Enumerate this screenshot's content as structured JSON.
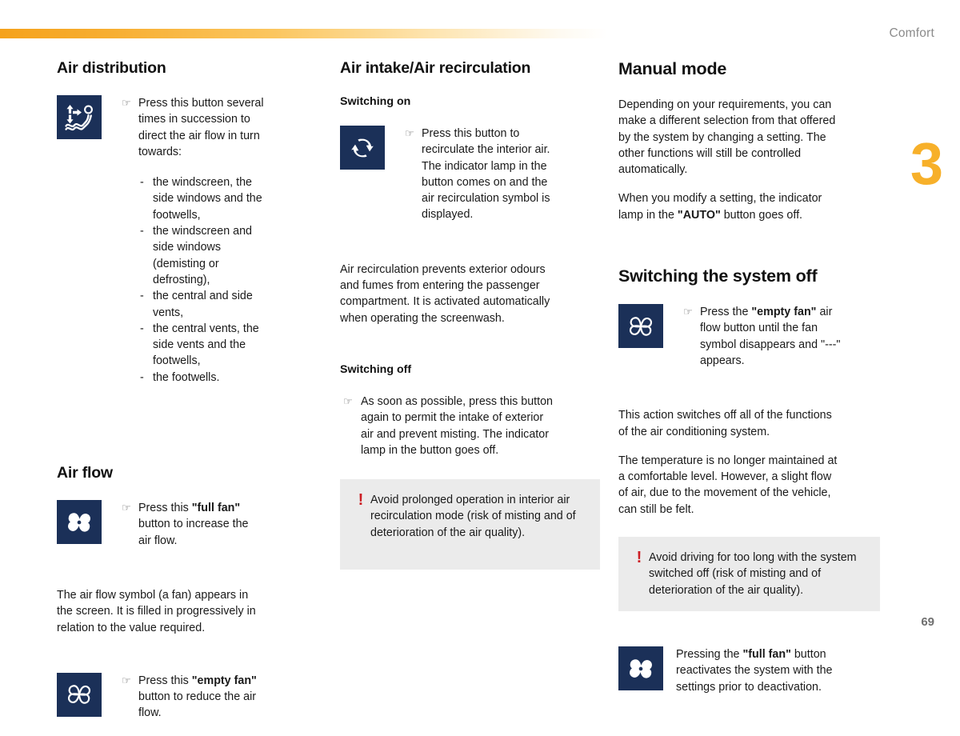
{
  "header": {
    "title": "Comfort",
    "band_color_start": "#f5a21c",
    "band_color_end": "#ffffff"
  },
  "chapter": {
    "number": "3",
    "color": "#f7b02a"
  },
  "page": {
    "number": "69"
  },
  "icon_panel_color": "#1b3058",
  "warning_color": "#cc1d23",
  "warning_bg": "#ebebeb",
  "hand_glyph": "☞",
  "column1": {
    "air_distribution": {
      "title": "Air distribution",
      "icon_name": "air-distribution-icon",
      "instruction": "Press this button several times in succession to direct the air flow in turn towards:",
      "bullets": [
        "the windscreen, the side windows and the footwells,",
        "the windscreen and side windows (demisting or defrosting),",
        "the central and side vents,",
        "the central vents, the side vents and the footwells,",
        "the footwells."
      ]
    },
    "air_flow": {
      "title": "Air flow",
      "full_fan_icon_name": "full-fan-icon",
      "full_fan_text_pre": "Press this ",
      "full_fan_text_bold": "\"full fan\"",
      "full_fan_text_post": " button to increase the air flow.",
      "paragraph": "The air flow symbol (a fan) appears in the screen. It is filled in progressively in relation to the value required.",
      "empty_fan_icon_name": "empty-fan-icon",
      "empty_fan_text_pre": "Press this ",
      "empty_fan_text_bold": "\"empty fan\"",
      "empty_fan_text_post": " button to reduce the air flow."
    }
  },
  "column2": {
    "air_intake": {
      "title": "Air intake/Air recirculation",
      "switching_on_label": "Switching on",
      "recirculation_icon_name": "air-recirculation-icon",
      "switching_on_text": "Press this button to recirculate the interior air. The indicator lamp in the button comes on and the air recirculation symbol is displayed.",
      "paragraph": "Air recirculation prevents exterior odours and fumes from entering the passenger compartment. It is activated automatically when operating the screenwash.",
      "switching_off_label": "Switching off",
      "switching_off_text": "As soon as possible, press this button again to permit the intake of exterior air and prevent misting. The indicator lamp in the button goes off.",
      "warning": "Avoid prolonged operation in interior air recirculation mode (risk of misting and of deterioration of the air quality)."
    }
  },
  "column3": {
    "manual_mode": {
      "title": "Manual mode",
      "paragraph1": "Depending on your requirements, you can make a different selection from that offered by the system by changing a setting. The other functions will still be controlled automatically.",
      "paragraph2_pre": "When you modify a setting, the indicator lamp in the ",
      "paragraph2_bold": "\"AUTO\"",
      "paragraph2_post": " button goes off."
    },
    "switching_off": {
      "title": "Switching the system off",
      "empty_fan_icon_name": "empty-fan-icon",
      "instruction_pre": "Press the ",
      "instruction_bold": "\"empty fan\"",
      "instruction_post": " air flow button until the fan symbol disappears and \"---\" appears.",
      "paragraph": "This action switches off all of the functions of the air conditioning system.\nThe temperature is no longer maintained at a comfortable level. However, a slight flow of air, due to the movement of the vehicle, can still be felt.",
      "paragraph_line1": "This action switches off all of the functions of the air conditioning system.",
      "paragraph_line2": "The temperature is no longer maintained at a comfortable level. However, a slight flow of air, due to the movement of the vehicle, can still be felt.",
      "warning": "Avoid driving for too long with the system switched off (risk of misting and of deterioration of the air quality).",
      "reactivate_icon_name": "full-fan-icon",
      "reactivate_pre": "Pressing the ",
      "reactivate_bold": "\"full fan\"",
      "reactivate_post": " button reactivates the system with the settings prior to deactivation."
    }
  }
}
